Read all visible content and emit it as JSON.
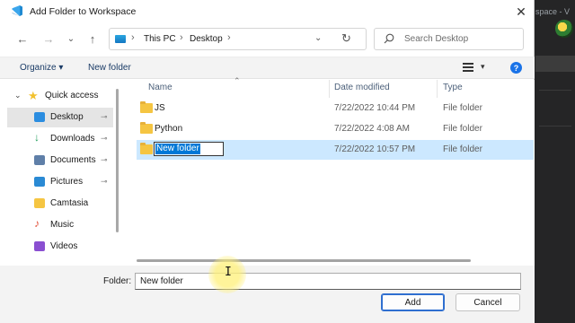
{
  "window": {
    "title": "Add Folder to Workspace",
    "close_glyph": "✕"
  },
  "background_app": {
    "title_fragment": "space - V"
  },
  "nav": {
    "back_glyph": "←",
    "forward_glyph": "→",
    "recent_glyph": "⌄",
    "up_glyph": "↑"
  },
  "address": {
    "segments": [
      "This PC",
      "Desktop"
    ],
    "separator": "›",
    "dropdown_glyph": "⌄",
    "refresh_glyph": "↻"
  },
  "search": {
    "placeholder": "Search Desktop"
  },
  "toolbar": {
    "organize_label": "Organize ▾",
    "new_folder_label": "New folder",
    "view_caret": "▾",
    "help_glyph": "?"
  },
  "sidebar": {
    "quick_access": {
      "label": "Quick access",
      "caret": "⌄",
      "star": "★"
    },
    "items": [
      {
        "label": "Desktop",
        "pinned": true,
        "selected": true,
        "icon": "desktop-icon",
        "color": "#2b8de0"
      },
      {
        "label": "Downloads",
        "pinned": true,
        "selected": false,
        "icon": "downloads-icon",
        "color": "#1e9e5a"
      },
      {
        "label": "Documents",
        "pinned": true,
        "selected": false,
        "icon": "documents-icon",
        "color": "#5f7fa8"
      },
      {
        "label": "Pictures",
        "pinned": true,
        "selected": false,
        "icon": "pictures-icon",
        "color": "#2a8ad4"
      },
      {
        "label": "Camtasia",
        "pinned": false,
        "selected": false,
        "icon": "folder-icon",
        "color": "#f5c542"
      },
      {
        "label": "Music",
        "pinned": false,
        "selected": false,
        "icon": "music-icon",
        "color": "#e2513b"
      },
      {
        "label": "Videos",
        "pinned": false,
        "selected": false,
        "icon": "videos-icon",
        "color": "#8a4fd1"
      }
    ],
    "pin_glyph": "📌"
  },
  "file_list": {
    "columns": {
      "name": "Name",
      "date": "Date modified",
      "type": "Type",
      "sort_glyph": "⌃"
    },
    "rows": [
      {
        "name": "JS",
        "date": "7/22/2022 10:44 PM",
        "type": "File folder",
        "selected": false,
        "renaming": false
      },
      {
        "name": "Python",
        "date": "7/22/2022 4:08 AM",
        "type": "File folder",
        "selected": false,
        "renaming": false
      },
      {
        "name": "New folder",
        "date": "7/22/2022 10:57 PM",
        "type": "File folder",
        "selected": true,
        "renaming": true
      }
    ]
  },
  "footer": {
    "folder_label": "Folder:",
    "folder_value": "New folder",
    "add_label": "Add",
    "cancel_label": "Cancel",
    "cursor_glyph": "I"
  },
  "colors": {
    "accent": "#0078d7",
    "selection": "#cce8ff",
    "folder": "#f5c542"
  }
}
